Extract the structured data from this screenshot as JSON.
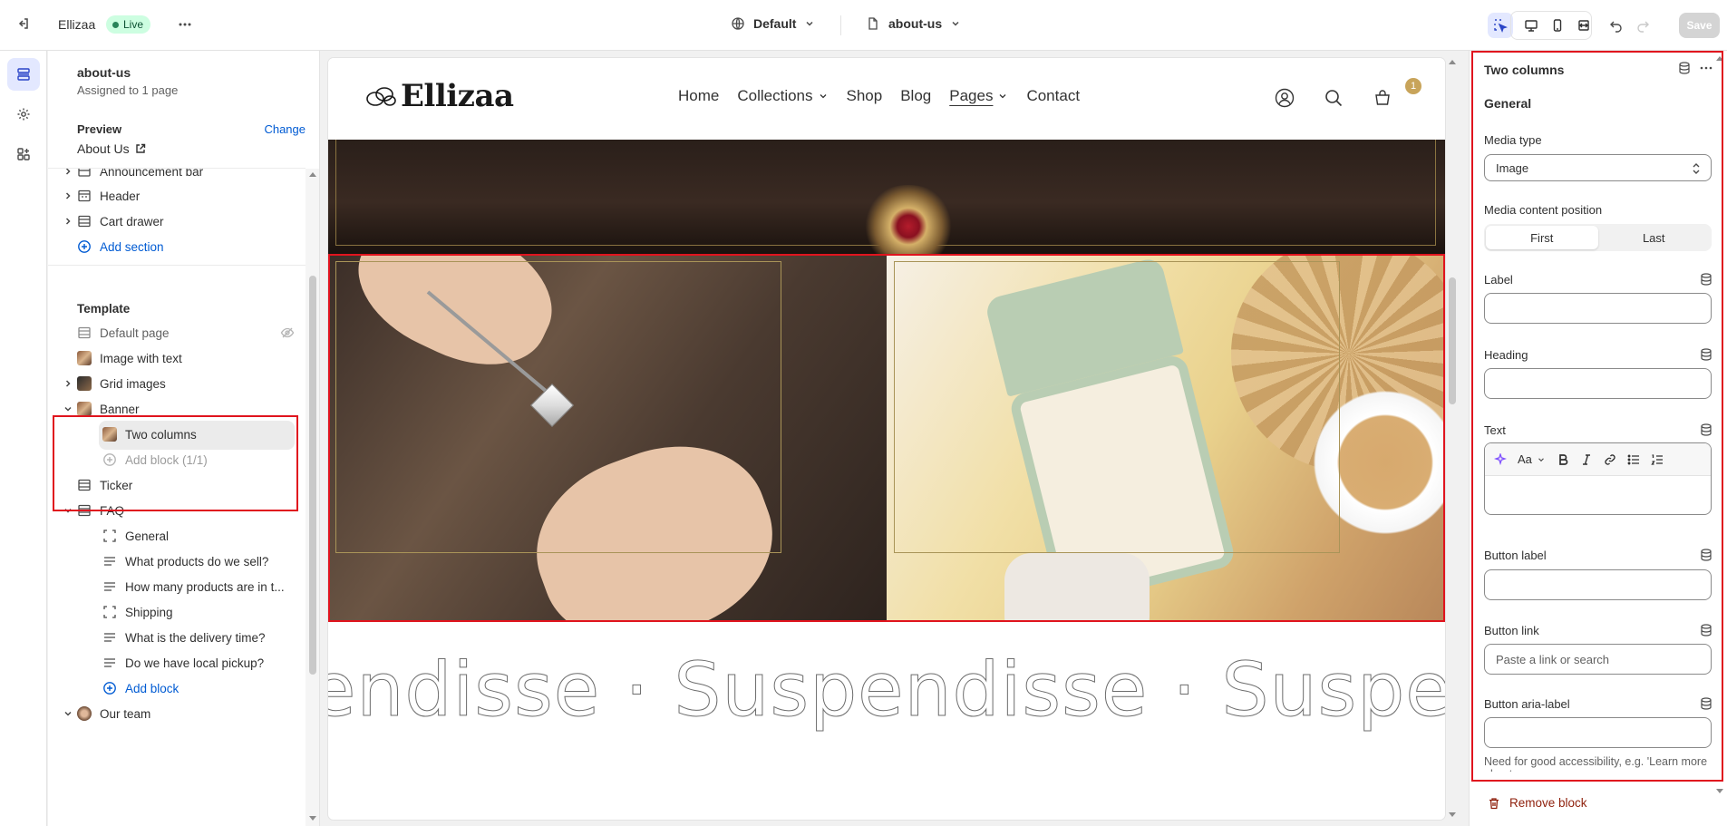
{
  "topbar": {
    "store_name": "Ellizaa",
    "status": "Live",
    "theme": "Default",
    "page": "about-us",
    "save_label": "Save"
  },
  "sidebar": {
    "title": "about-us",
    "subtitle": "Assigned to 1 page",
    "preview_label": "Preview",
    "change_label": "Change",
    "preview_page": "About Us",
    "header_items": [
      {
        "label": "Announcement bar"
      },
      {
        "label": "Header"
      },
      {
        "label": "Cart drawer"
      }
    ],
    "add_section": "Add section",
    "template_label": "Template",
    "template_items": [
      {
        "label": "Default page"
      },
      {
        "label": "Image with text"
      },
      {
        "label": "Grid images"
      },
      {
        "label": "Banner"
      },
      {
        "label": "Two columns"
      },
      {
        "label": "Add block (1/1)"
      },
      {
        "label": "Ticker"
      },
      {
        "label": "FAQ"
      },
      {
        "label": "General"
      },
      {
        "label": "What products do we sell?"
      },
      {
        "label": "How many products are in t..."
      },
      {
        "label": "Shipping"
      },
      {
        "label": "What is the delivery time?"
      },
      {
        "label": "Do we have local pickup?"
      },
      {
        "label": "Add block"
      },
      {
        "label": "Our team"
      }
    ]
  },
  "store_preview": {
    "logo": "Ellizaa",
    "nav": [
      {
        "label": "Home"
      },
      {
        "label": "Collections"
      },
      {
        "label": "Shop"
      },
      {
        "label": "Blog"
      },
      {
        "label": "Pages"
      },
      {
        "label": "Contact"
      }
    ],
    "cart_count": "1",
    "ticker_text": "endisse · Suspendisse · Suspendi"
  },
  "panel": {
    "title": "Two columns",
    "section": "General",
    "media_type_label": "Media type",
    "media_type_value": "Image",
    "media_position_label": "Media content position",
    "position_options": [
      "First",
      "Last"
    ],
    "label_label": "Label",
    "heading_label": "Heading",
    "text_label": "Text",
    "button_label_label": "Button label",
    "button_link_label": "Button link",
    "button_link_placeholder": "Paste a link or search",
    "button_aria_label": "Button aria-label",
    "help_text": "Need for good accessibility, e.g. 'Learn more about...",
    "remove_label": "Remove block",
    "rte_font_label": "Aa"
  },
  "colors": {
    "accent": "#005bd3",
    "highlight": "#e0141e",
    "live_bg": "#cdfee1",
    "danger": "#8e1f0b"
  }
}
